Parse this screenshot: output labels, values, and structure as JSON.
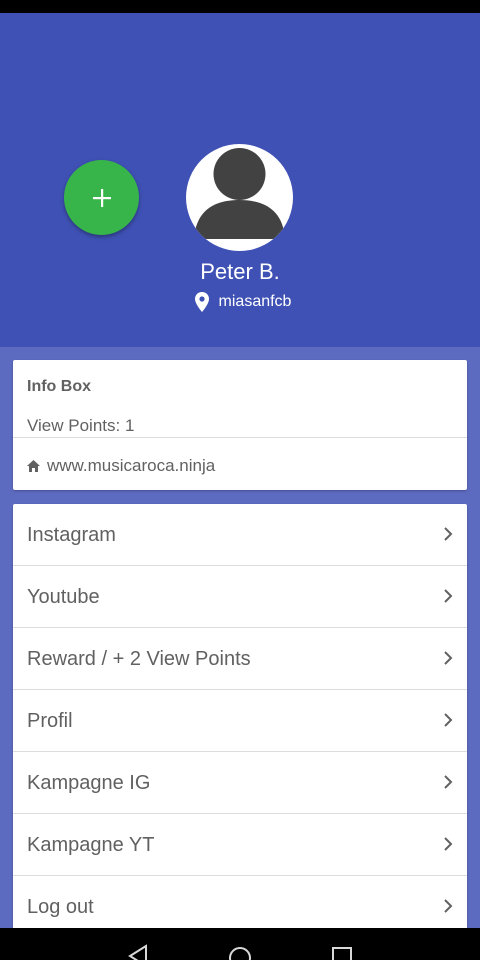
{
  "profile": {
    "name": "Peter B.",
    "username": "miasanfcb"
  },
  "info_box": {
    "title": "Info Box",
    "view_points": "View Points: 1",
    "website": "www.musicaroca.ninja"
  },
  "menu": {
    "items": [
      {
        "label": "Instagram"
      },
      {
        "label": "Youtube"
      },
      {
        "label": "Reward / + 2 View Points"
      },
      {
        "label": "Profil"
      },
      {
        "label": "Kampagne IG"
      },
      {
        "label": "Kampagne YT"
      },
      {
        "label": "Log out"
      }
    ]
  },
  "colors": {
    "header": "#3f51b5",
    "background": "#5c6bc0",
    "fab": "#38b54a",
    "text": "#616161"
  },
  "icons": {
    "fab": "plus-icon",
    "location": "location-pin-icon",
    "website": "home-icon",
    "menu_item": "chevron-right-icon",
    "nav": [
      "back-icon",
      "home-nav-icon",
      "recents-icon"
    ]
  }
}
